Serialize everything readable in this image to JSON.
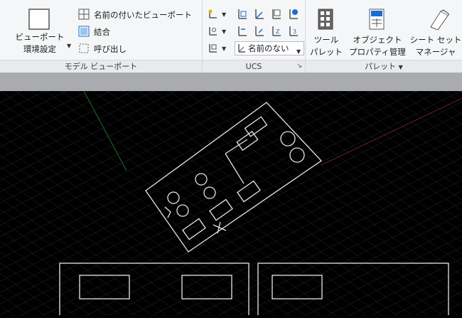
{
  "ribbon": {
    "viewports_group": {
      "label": "モデル ビューポート",
      "viewport_config_line1": "ビューポート",
      "viewport_config_line2": "環境設定",
      "named_viewports": "名前の付いたビューポート",
      "join": "結合",
      "restore": "呼び出し"
    },
    "ucs_group": {
      "label": "UCS",
      "named_ucs_combo": "名前のない"
    },
    "palettes_group": {
      "label": "パレット",
      "tool_palettes_line1": "ツール",
      "tool_palettes_line2": "パレット",
      "properties_line1": "オブジェクト",
      "properties_line2": "プロパティ管理",
      "sheetset_line1": "シート セット",
      "sheetset_line2": "マネージャ"
    }
  },
  "icons": [
    "viewport-config-icon",
    "named-viewports-icon",
    "join-icon",
    "restore-icon",
    "ucs-icon",
    "dropdown-arrow-icon",
    "tool-palette-icon",
    "properties-icon",
    "sheetset-icon",
    "dialog-launcher-icon"
  ],
  "colors": {
    "ribbon_bg": "#f5f6f7",
    "canvas_bg": "#000000",
    "ucs_blue": "#1c6dd0"
  }
}
